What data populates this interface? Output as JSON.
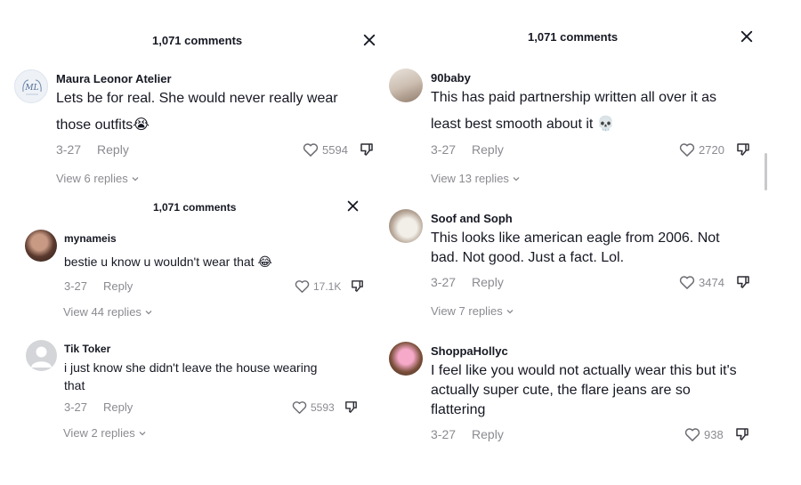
{
  "panel_a": {
    "header": "1,071 comments",
    "comment": {
      "user": "Maura Leonor Atelier",
      "text_line1": "Lets be for real. She would never really wear",
      "text_line2": "those outfits😭",
      "date": "3-27",
      "reply": "Reply",
      "likes": "5594",
      "view_replies": "View 6 replies"
    }
  },
  "panel_b": {
    "header": "1,071 comments",
    "comments": [
      {
        "user": "mynameis",
        "text": "bestie u know u wouldn't wear that 😂",
        "date": "3-27",
        "reply": "Reply",
        "likes": "17.1K",
        "view_replies": "View 44 replies"
      },
      {
        "user": "Tik Toker",
        "text_line1": "i just know she didn't leave the house wearing",
        "text_line2": "that",
        "date": "3-27",
        "reply": "Reply",
        "likes": "5593",
        "view_replies": "View 2 replies"
      }
    ]
  },
  "panel_c": {
    "header": "1,071 comments",
    "comments": [
      {
        "user": "90baby",
        "text_line1": "This has paid partnership written all over it as",
        "text_line2": "least best smooth about it 💀",
        "date": "3-27",
        "reply": "Reply",
        "likes": "2720",
        "view_replies": "View 13 replies"
      },
      {
        "user": "Soof and Soph",
        "text_line1": "This looks like american eagle from 2006. Not",
        "text_line2": "bad. Not good. Just a fact. Lol.",
        "date": "3-27",
        "reply": "Reply",
        "likes": "3474",
        "view_replies": "View 7 replies"
      },
      {
        "user": "ShoppaHollyc",
        "text_line1": "I feel like you would not actually wear this but it's",
        "text_line2": "actually super cute, the flare jeans are so",
        "text_line3": "flattering",
        "date": "3-27",
        "reply": "Reply",
        "likes": "938"
      }
    ]
  },
  "icons": {
    "close": "close-icon",
    "like": "heart-icon",
    "dislike": "thumbs-down-icon",
    "expand": "chevron-down-icon"
  },
  "colors": {
    "text": "#161823",
    "muted": "#8a8b91"
  }
}
